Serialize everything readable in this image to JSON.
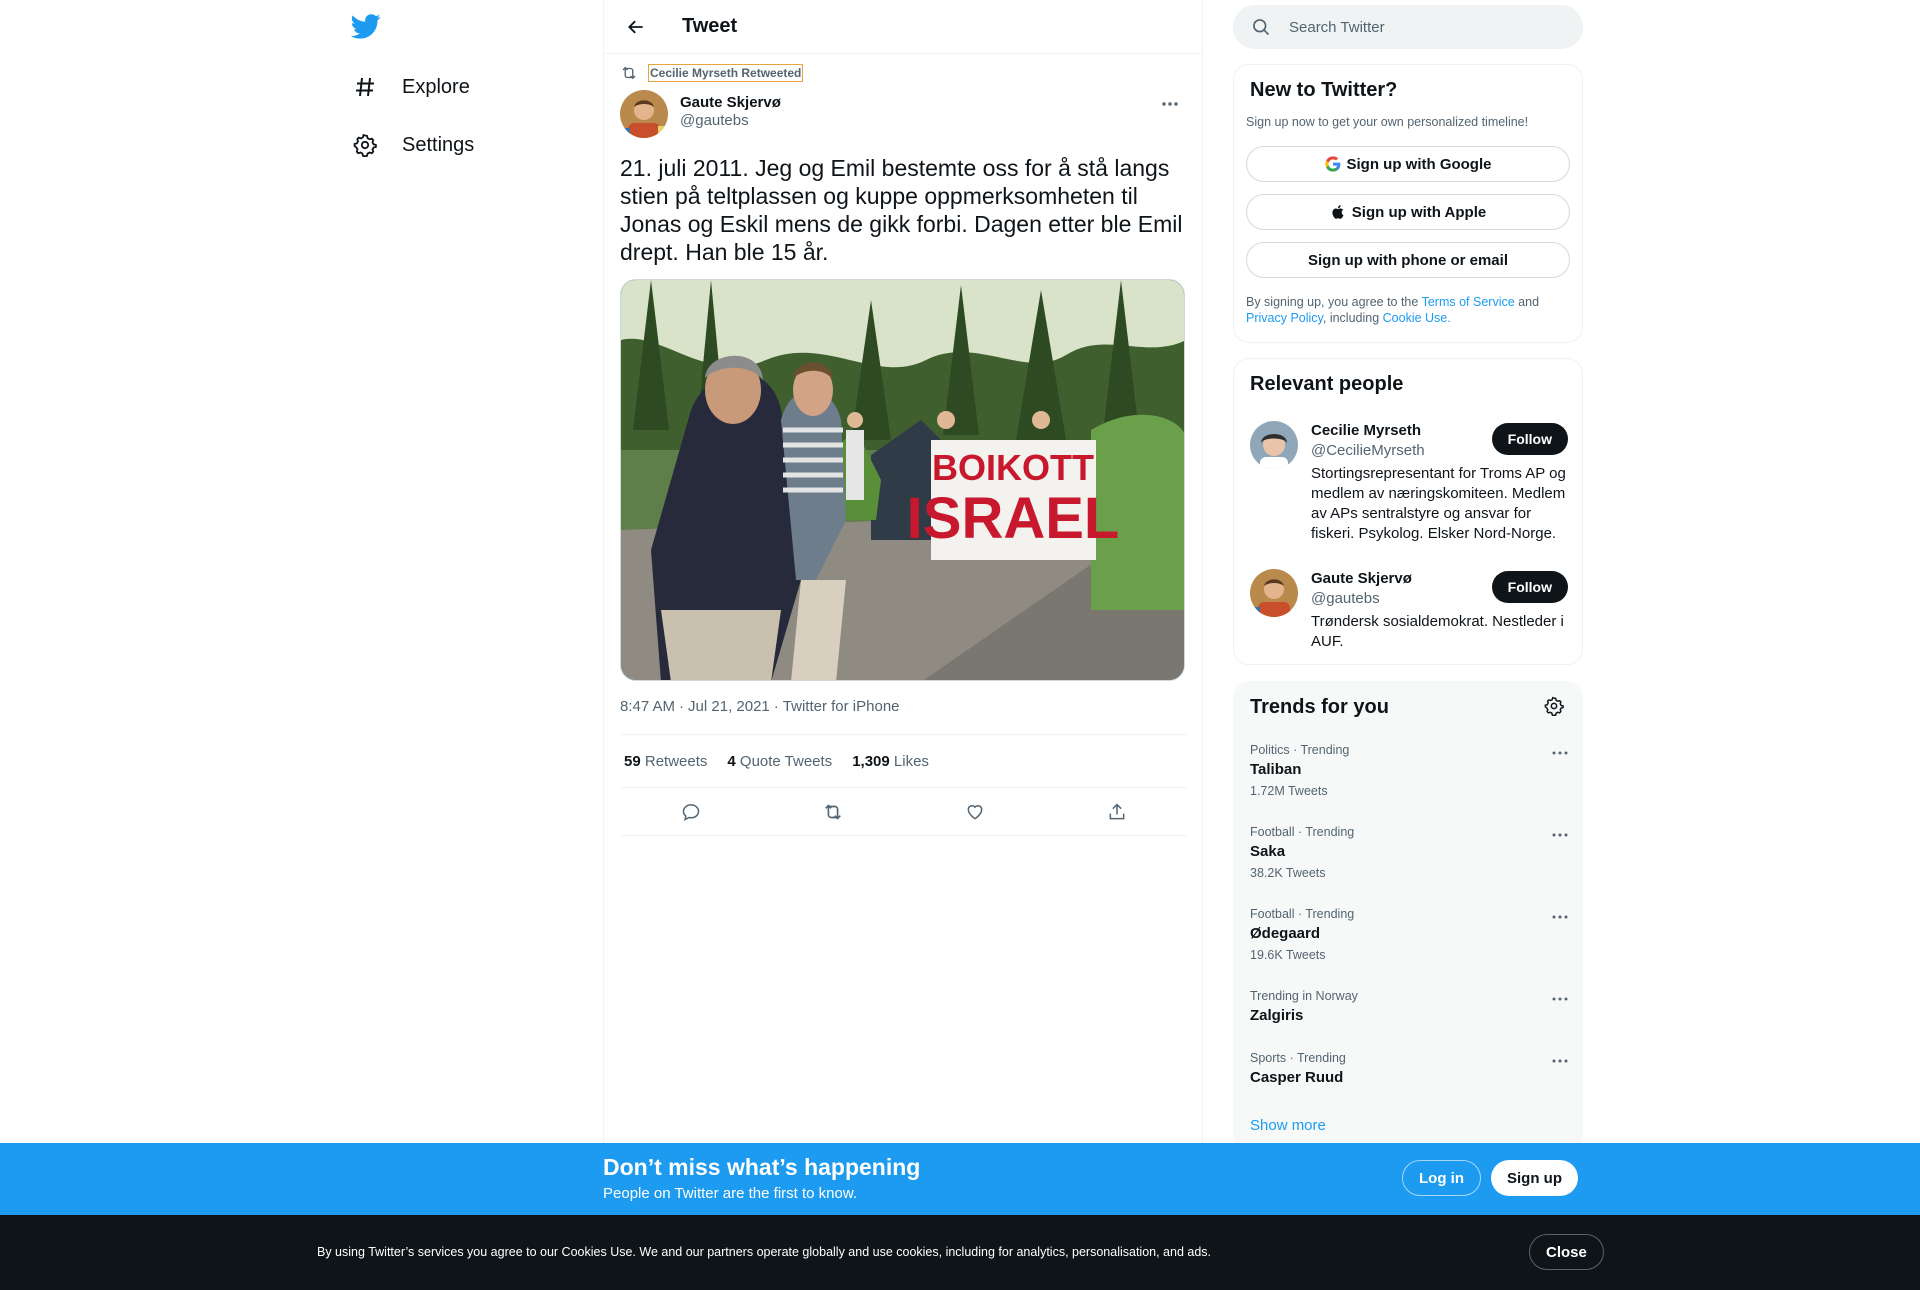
{
  "colors": {
    "brand": "#1d9bf0",
    "text": "#0f1419",
    "secondary": "#536471",
    "border": "#eff3f4"
  },
  "nav": {
    "logo_icon": "twitter-bird-icon",
    "items": [
      {
        "label": "Explore",
        "icon": "hashtag-icon"
      },
      {
        "label": "Settings",
        "icon": "gear-icon"
      }
    ]
  },
  "header": {
    "title": "Tweet",
    "back_icon": "back-arrow-icon"
  },
  "tweet": {
    "retweet_context": "Cecilie Myrseth Retweeted",
    "author_name": "Gaute Skjervø",
    "author_handle": "@gautebs",
    "text": "21. juli 2011. Jeg og Emil bestemte oss for å stå langs stien på teltplassen og kuppe oppmerksomheten til Jonas og Eskil mens de gikk forbi. Dagen etter ble Emil drept. Han ble 15 år.",
    "banner_text": [
      "BOIKOTT",
      "ISRAEL"
    ],
    "time": "8:47 AM",
    "date": "Jul 21, 2021",
    "source": "Twitter for iPhone",
    "separator": "·",
    "stats": {
      "retweets_count": "59",
      "retweets_label": "Retweets",
      "quotes_count": "4",
      "quotes_label": "Quote Tweets",
      "likes_count": "1,309",
      "likes_label": "Likes"
    }
  },
  "search": {
    "placeholder": "Search Twitter"
  },
  "new_to_twitter": {
    "title": "New to Twitter?",
    "subtitle": "Sign up now to get your own personalized timeline!",
    "google": "Sign up with Google",
    "apple": "Sign up with Apple",
    "phone": "Sign up with phone or email",
    "legal_prefix": "By signing up, you agree to the ",
    "terms": "Terms of Service",
    "and": " and ",
    "privacy": "Privacy Policy",
    "including": ", including ",
    "cookie": "Cookie Use."
  },
  "relevant_people": {
    "title": "Relevant people",
    "follow_label": "Follow",
    "people": [
      {
        "name": "Cecilie Myrseth",
        "handle": "@CecilieMyrseth",
        "bio": "Stortingsrepresentant for Troms AP og medlem av næringskomiteen. Medlem av APs sentralstyre og ansvar for fiskeri. Psykolog. Elsker Nord-Norge."
      },
      {
        "name": "Gaute Skjervø",
        "handle": "@gautebs",
        "bio": "Trøndersk sosialdemokrat. Nestleder i AUF."
      }
    ]
  },
  "trends": {
    "title": "Trends for you",
    "show_more": "Show more",
    "items": [
      {
        "context": "Politics · Trending",
        "name": "Taliban",
        "count": "1.72M Tweets"
      },
      {
        "context": "Football · Trending",
        "name": "Saka",
        "count": "38.2K Tweets"
      },
      {
        "context": "Football · Trending",
        "name": "Ødegaard",
        "count": "19.6K Tweets"
      },
      {
        "context": "Trending in Norway",
        "name": "Zalgiris",
        "count": ""
      },
      {
        "context": "Sports · Trending",
        "name": "Casper Ruud",
        "count": ""
      }
    ]
  },
  "bottom_bar": {
    "title": "Don’t miss what’s happening",
    "subtitle": "People on Twitter are the first to know.",
    "login": "Log in",
    "signup": "Sign up"
  },
  "cookie_bar": {
    "text": "By using Twitter’s services you agree to our Cookies Use. We and our partners operate globally and use cookies, including for analytics, personalisation, and ads.",
    "close": "Close"
  }
}
